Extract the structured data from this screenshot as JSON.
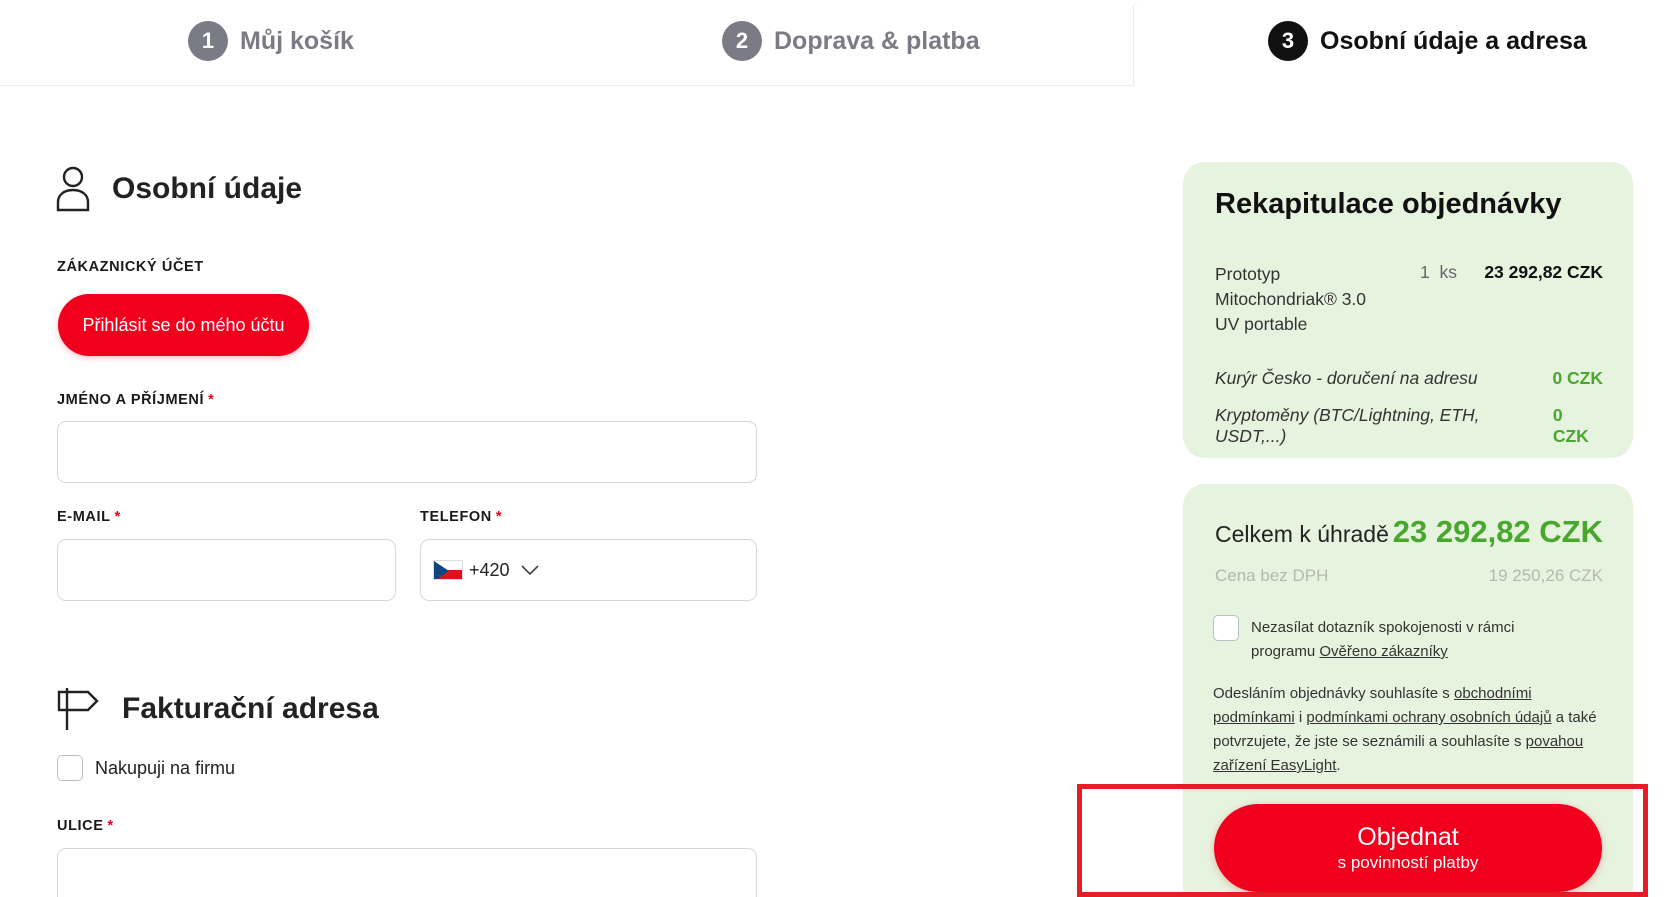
{
  "steps": [
    {
      "number": "1",
      "label": "Můj košík",
      "active": false
    },
    {
      "number": "2",
      "label": "Doprava & platba",
      "active": false
    },
    {
      "number": "3",
      "label": "Osobní údaje a adresa",
      "active": true
    }
  ],
  "personal": {
    "title": "Osobní údaje",
    "icon": "user-icon",
    "account_label": "ZÁKAZNICKÝ ÚČET",
    "login_button": "Přihlásit se do mého účtu",
    "name_label": "JMÉNO A PŘÍJMENÍ",
    "email_label": "E-MAIL",
    "phone_label": "TELEFON",
    "phone_prefix": "+420",
    "required_mark": "*"
  },
  "billing": {
    "title": "Fakturační adresa",
    "icon": "signpost-icon",
    "company_checkbox_label": "Nakupuji na firmu",
    "street_label": "ULICE"
  },
  "recap": {
    "title": "Rekapitulace objednávky",
    "item": {
      "name": "Prototyp Mitochondriak® 3.0 UV portable",
      "qty": "1",
      "unit": "ks",
      "price": "23 292,82 CZK"
    },
    "shipping": [
      {
        "name": "Kurýr Česko - doručení na adresu",
        "price": "0 CZK"
      },
      {
        "name": "Kryptoměny (BTC/Lightning, ETH, USDT,...)",
        "price": "0 CZK"
      }
    ]
  },
  "totals": {
    "total_label": "Celkem k úhradě",
    "total_value": "23 292,82 CZK",
    "nodph_label": "Cena bez DPH",
    "nodph_value": "19 250,26 CZK",
    "survey_text": "Nezasílat dotazník spokojenosti v rámci programu",
    "survey_link": "Ověřeno zákazníky",
    "terms_1": "Odesláním objednávky souhlasíte s",
    "terms_link_1": "obchodními podmínkami",
    "terms_2": "i",
    "terms_link_2": "podmínkami ochrany osobních údajů",
    "terms_3": "a také potvrzujete, že jste se seznámili a souhlasíte s",
    "terms_link_3": "povahou zařízení EasyLight",
    "terms_4": ".",
    "order_button_main": "Objednat",
    "order_button_sub": "s povinností platby"
  },
  "colors": {
    "accent_red": "#f0001c",
    "summary_bg": "#e6f3df",
    "price_green": "#4aa72e",
    "highlight_red": "#e31e26"
  }
}
